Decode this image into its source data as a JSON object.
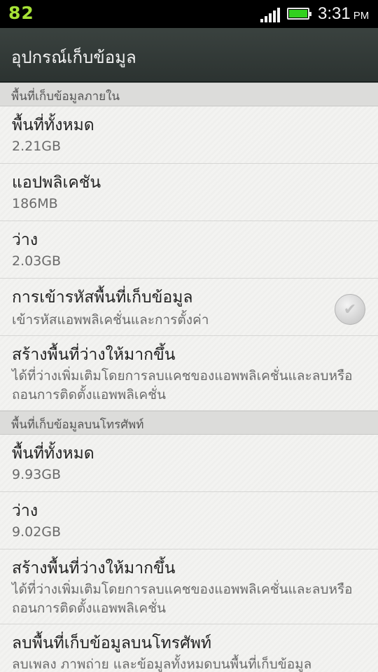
{
  "status_bar": {
    "left_badge": "82",
    "time": "3:31",
    "ampm": "PM",
    "battery_level": 1.0,
    "signal_bars": 5
  },
  "title": "อุปกรณ์เก็บข้อมูล",
  "internal_section": {
    "header": "พื้นที่เก็บข้อมูลภายใน",
    "total_label": "พื้นที่ทั้งหมด",
    "total_value": "2.21GB",
    "apps_label": "แอปพลิเคชัน",
    "apps_value": "186MB",
    "free_label": "ว่าง",
    "free_value": "2.03GB",
    "encrypt_label": "การเข้ารหัสพื้นที่เก็บข้อมูล",
    "encrypt_desc": "เข้ารหัสแอพพลิเคชั่นและการตั้งค่า",
    "encrypt_checked": false,
    "free_up_label": "สร้างพื้นที่ว่างให้มากขึ้น",
    "free_up_desc": "ได้ที่ว่างเพิ่มเติมโดยการลบแคชของแอพพลิเคชั่นและลบหรือถอนการติดตั้งแอพพลิเคชั่น"
  },
  "phone_section": {
    "header": "พื้นที่เก็บข้อมูลบนโทรศัพท์",
    "total_label": "พื้นที่ทั้งหมด",
    "total_value": "9.93GB",
    "free_label": "ว่าง",
    "free_value": "9.02GB",
    "free_up_label": "สร้างพื้นที่ว่างให้มากขึ้น",
    "free_up_desc": "ได้ที่ว่างเพิ่มเติมโดยการลบแคชของแอพพลิเคชั่นและลบหรือถอนการติดตั้งแอพพลิเคชั่น",
    "erase_label": "ลบพื้นที่เก็บข้อมูลบนโทรศัพท์",
    "erase_desc": "ลบเพลง ภาพถ่าย และข้อมูลทั้งหมดบนพื้นที่เก็บข้อมูล"
  }
}
